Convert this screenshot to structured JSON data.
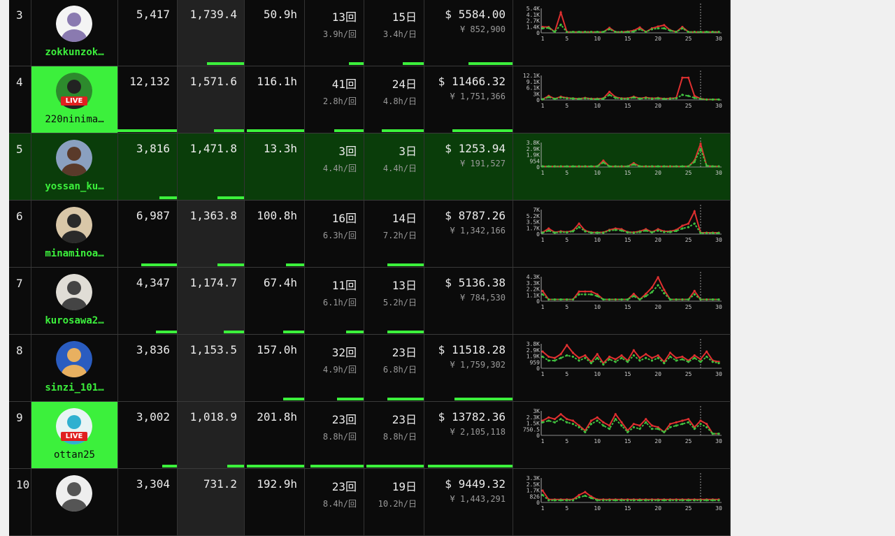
{
  "rows": [
    {
      "rank": "3",
      "user": "zokkunzok…",
      "live": false,
      "avatar": "robot-avatar",
      "followers": "5,417",
      "score": "1,739.4",
      "hours": "50.9h",
      "streams": "13回",
      "per_stream": "3.9h/回",
      "days": "15日",
      "per_day": "3.4h/日",
      "usd": "$ 5584.00",
      "jpy": "¥ 852,900",
      "bars": [
        0.0,
        0.55,
        0.0,
        0.25,
        0.35,
        0.5,
        0.55
      ],
      "y_ticks": [
        "5.4K",
        "4.1K",
        "2.7K",
        "1.4K",
        "0"
      ],
      "x_ticks": [
        "1",
        "5",
        "10",
        "15",
        "20",
        "25",
        "30"
      ],
      "red": [
        1.3,
        1.3,
        0.2,
        4.5,
        0.2,
        0.2,
        0.2,
        0.2,
        0.2,
        0.2,
        0.2,
        1.1,
        0.2,
        0.2,
        0.3,
        0.5,
        1.2,
        0.2,
        1.0,
        1.4,
        1.7,
        0.6,
        0.2,
        1.3,
        0.2,
        0.2,
        0.2,
        0.2,
        0.2,
        0.2
      ],
      "green": [
        1.0,
        1.1,
        0.2,
        1.8,
        0.2,
        0.2,
        0.2,
        0.2,
        0.2,
        0.2,
        0.2,
        0.8,
        0.2,
        0.2,
        0.2,
        0.3,
        0.8,
        0.2,
        0.8,
        1.0,
        1.0,
        0.5,
        0.2,
        1.0,
        0.2,
        0.2,
        0.2,
        0.2,
        0.2,
        0.2
      ],
      "ymax": 5.4
    },
    {
      "rank": "4",
      "user": "220ninima…",
      "live": true,
      "avatar": "cap-man-avatar",
      "followers": "12,132",
      "score": "1,571.6",
      "hours": "116.1h",
      "streams": "41回",
      "per_stream": "2.8h/回",
      "days": "24日",
      "per_day": "4.8h/日",
      "usd": "$ 11466.32",
      "jpy": "¥ 1,751,366",
      "bars": [
        1.0,
        0.45,
        0.95,
        0.5,
        0.7,
        0.68,
        0.85
      ],
      "y_ticks": [
        "12.1K",
        "9.1K",
        "6.1K",
        "3K",
        "0"
      ],
      "x_ticks": [
        "1",
        "5",
        "10",
        "15",
        "20",
        "25",
        "30"
      ],
      "red": [
        0.3,
        2.0,
        0.6,
        1.6,
        1.0,
        0.8,
        0.6,
        1.0,
        0.6,
        0.6,
        0.8,
        4.0,
        1.4,
        0.8,
        0.8,
        1.6,
        0.8,
        1.2,
        0.8,
        1.0,
        0.6,
        0.8,
        1.0,
        11.0,
        11.0,
        2.0,
        0.6,
        0.2,
        0.2,
        0.2
      ],
      "green": [
        0.3,
        1.4,
        0.5,
        1.2,
        0.8,
        0.7,
        0.5,
        0.8,
        0.5,
        0.4,
        0.6,
        2.5,
        1.0,
        0.6,
        0.6,
        1.2,
        0.6,
        0.9,
        0.6,
        0.8,
        0.5,
        0.6,
        0.8,
        2.5,
        2.0,
        1.0,
        0.5,
        0.2,
        0.2,
        0.2
      ],
      "ymax": 12.1
    },
    {
      "rank": "5",
      "user": "yossan_ku…",
      "live": false,
      "highlight": true,
      "avatar": "bearded-man-avatar",
      "followers": "3,816",
      "score": "1,471.8",
      "hours": "13.3h",
      "streams": "3回",
      "per_stream": "4.4h/回",
      "days": "3日",
      "per_day": "4.4h/日",
      "usd": "$ 1253.94",
      "jpy": "¥ 191,527",
      "bars": [
        0.3,
        0.4,
        0.0,
        0.0,
        0.0,
        0.0,
        0.05
      ],
      "y_ticks": [
        "3.8K",
        "2.9K",
        "1.9K",
        "954",
        "0"
      ],
      "x_ticks": [
        "1",
        "5",
        "10",
        "15",
        "20",
        "25",
        "30"
      ],
      "red": [
        0.1,
        0.1,
        0.1,
        0.1,
        0.1,
        0.1,
        0.1,
        0.1,
        0.1,
        0.1,
        1.0,
        0.1,
        0.1,
        0.1,
        0.1,
        0.6,
        0.1,
        0.1,
        0.1,
        0.1,
        0.1,
        0.1,
        0.1,
        0.1,
        0.1,
        1.0,
        3.6,
        0.2,
        0.1,
        0.1
      ],
      "green": [
        0.1,
        0.1,
        0.1,
        0.1,
        0.1,
        0.1,
        0.1,
        0.1,
        0.1,
        0.1,
        0.7,
        0.1,
        0.1,
        0.1,
        0.1,
        0.4,
        0.1,
        0.1,
        0.1,
        0.1,
        0.1,
        0.1,
        0.1,
        0.1,
        0.1,
        0.8,
        2.8,
        0.2,
        0.1,
        0.1
      ],
      "ymax": 3.8
    },
    {
      "rank": "6",
      "user": "minaminoa…",
      "live": false,
      "avatar": "glasses-man-avatar",
      "followers": "6,987",
      "score": "1,363.8",
      "hours": "100.8h",
      "streams": "16回",
      "per_stream": "6.3h/回",
      "days": "14日",
      "per_day": "7.2h/日",
      "usd": "$ 8787.26",
      "jpy": "¥ 1,342,166",
      "bars": [
        0.6,
        0.4,
        0.3,
        0.0,
        0.6,
        0.0,
        0.6
      ],
      "y_ticks": [
        "7K",
        "5.2K",
        "3.5K",
        "1.7K",
        "0"
      ],
      "x_ticks": [
        "1",
        "5",
        "10",
        "15",
        "20",
        "25",
        "30"
      ],
      "red": [
        0.5,
        1.6,
        0.5,
        0.8,
        0.6,
        1.0,
        3.0,
        1.0,
        0.5,
        0.5,
        0.5,
        1.2,
        1.6,
        1.4,
        0.6,
        0.5,
        0.8,
        1.4,
        0.6,
        1.4,
        0.8,
        0.8,
        1.2,
        2.4,
        3.0,
        6.5,
        0.4,
        0.4,
        0.4,
        0.4
      ],
      "green": [
        0.4,
        1.0,
        0.4,
        0.6,
        0.5,
        0.8,
        2.0,
        0.8,
        0.4,
        0.4,
        0.4,
        1.0,
        1.2,
        1.0,
        0.5,
        0.4,
        0.6,
        1.0,
        0.5,
        1.0,
        0.6,
        0.6,
        0.9,
        1.6,
        2.0,
        3.0,
        0.3,
        0.3,
        0.3,
        0.3
      ],
      "ymax": 7.0
    },
    {
      "rank": "7",
      "user": "kurosawa2…",
      "live": false,
      "avatar": "standing-man-avatar",
      "followers": "4,347",
      "score": "1,174.7",
      "hours": "67.4h",
      "streams": "11回",
      "per_stream": "6.1h/回",
      "days": "13日",
      "per_day": "5.2h/日",
      "usd": "$ 5136.38",
      "jpy": "¥ 784,530",
      "bars": [
        0.35,
        0.3,
        0.35,
        0.3,
        0.6,
        0.0,
        0.3
      ],
      "y_ticks": [
        "4.3K",
        "3.3K",
        "2.2K",
        "1.1K",
        "0"
      ],
      "x_ticks": [
        "1",
        "5",
        "10",
        "15",
        "20",
        "25",
        "30"
      ],
      "red": [
        1.8,
        0.3,
        0.3,
        0.3,
        0.3,
        0.3,
        1.7,
        1.7,
        1.7,
        1.2,
        0.3,
        0.3,
        0.3,
        0.3,
        0.3,
        1.3,
        0.3,
        1.3,
        2.4,
        4.2,
        2.0,
        0.3,
        0.3,
        0.3,
        0.3,
        1.8,
        0.3,
        0.3,
        0.3,
        0.3
      ],
      "green": [
        1.2,
        0.3,
        0.3,
        0.3,
        0.3,
        0.3,
        1.2,
        1.2,
        1.2,
        0.9,
        0.3,
        0.3,
        0.3,
        0.3,
        0.3,
        0.9,
        0.3,
        0.9,
        1.6,
        2.8,
        1.4,
        0.3,
        0.3,
        0.3,
        0.3,
        1.2,
        0.3,
        0.3,
        0.3,
        0.3
      ],
      "ymax": 4.3
    },
    {
      "rank": "8",
      "user": "sinzi_101…",
      "live": false,
      "avatar": "cartoon-badge-avatar",
      "followers": "3,836",
      "score": "1,153.5",
      "hours": "157.0h",
      "streams": "32回",
      "per_stream": "4.9h/回",
      "days": "23日",
      "per_day": "6.8h/日",
      "usd": "$ 11518.28",
      "jpy": "¥ 1,759,302",
      "bars": [
        0.0,
        0.0,
        0.35,
        0.45,
        0.6,
        0.65,
        0.5
      ],
      "y_ticks": [
        "3.8K",
        "2.9K",
        "1.9K",
        "959",
        "0"
      ],
      "x_ticks": [
        "1",
        "5",
        "10",
        "15",
        "20",
        "25",
        "30"
      ],
      "red": [
        2.6,
        1.8,
        1.6,
        2.2,
        3.6,
        2.4,
        1.6,
        2.0,
        1.0,
        2.2,
        0.8,
        1.8,
        1.4,
        2.0,
        1.2,
        2.8,
        1.6,
        2.2,
        1.6,
        2.0,
        1.0,
        2.4,
        1.6,
        1.8,
        1.2,
        2.0,
        1.4,
        2.6,
        1.2,
        1.0
      ],
      "green": [
        1.8,
        1.2,
        1.2,
        1.6,
        2.0,
        1.8,
        1.2,
        1.6,
        0.8,
        1.6,
        0.6,
        1.4,
        1.0,
        1.6,
        1.0,
        2.0,
        1.2,
        1.6,
        1.2,
        1.6,
        0.8,
        1.8,
        1.2,
        1.4,
        1.0,
        1.6,
        1.0,
        1.8,
        1.0,
        0.8
      ],
      "ymax": 3.8
    },
    {
      "rank": "9",
      "user": "ottan25",
      "live": true,
      "avatar": "blue-character-avatar",
      "followers": "3,002",
      "score": "1,018.9",
      "hours": "201.8h",
      "streams": "23回",
      "per_stream": "8.8h/回",
      "days": "23日",
      "per_day": "8.8h/日",
      "usd": "$ 13782.36",
      "jpy": "¥ 2,105,118",
      "bars": [
        0.25,
        0.25,
        0.95,
        0.9,
        0.95,
        0.95,
        0.8
      ],
      "y_ticks": [
        "3K",
        "2.3K",
        "1.5K",
        "750.5",
        "0"
      ],
      "x_ticks": [
        "1",
        "5",
        "10",
        "15",
        "20",
        "25",
        "30"
      ],
      "red": [
        1.8,
        2.2,
        2.0,
        2.6,
        2.0,
        1.8,
        1.2,
        0.6,
        1.8,
        2.2,
        1.6,
        1.2,
        2.6,
        1.6,
        0.6,
        1.4,
        1.2,
        2.0,
        1.2,
        1.0,
        0.4,
        1.4,
        1.6,
        1.8,
        2.0,
        1.0,
        1.8,
        1.4,
        0.2,
        0.2
      ],
      "green": [
        1.6,
        1.8,
        1.6,
        2.0,
        1.6,
        1.4,
        1.0,
        0.4,
        1.4,
        1.8,
        1.2,
        0.8,
        2.0,
        1.2,
        0.4,
        1.0,
        0.8,
        1.6,
        0.8,
        0.8,
        0.4,
        1.0,
        1.2,
        1.4,
        1.6,
        0.8,
        1.4,
        1.0,
        0.2,
        0.2
      ],
      "ymax": 3.0
    },
    {
      "rank": "10",
      "user": "",
      "live": false,
      "avatar": "sketch-man-avatar",
      "followers": "3,304",
      "score": "731.2",
      "hours": "192.9h",
      "streams": "23回",
      "per_stream": "8.4h/回",
      "days": "19日",
      "per_day": "10.2h/日",
      "usd": "$ 9449.32",
      "jpy": "¥ 1,443,291",
      "bars": [
        0,
        0,
        0,
        0,
        0,
        0,
        0
      ],
      "y_ticks": [
        "3.3K",
        "2.5K",
        "1.7K",
        "826",
        "0"
      ],
      "x_ticks": [
        "1",
        "5",
        "10",
        "15",
        "20",
        "25",
        "30"
      ],
      "red": [
        1.6,
        0.4,
        0.4,
        0.4,
        0.4,
        0.4,
        1.0,
        1.4,
        0.8,
        0.4,
        0.4,
        0.4,
        0.4,
        0.4,
        0.4,
        0.4,
        0.4,
        0.4,
        0.4,
        0.4,
        0.4,
        0.4,
        0.4,
        0.4,
        0.4,
        0.4,
        0.4,
        0.4,
        0.4,
        0.4
      ],
      "green": [
        1.0,
        0.3,
        0.3,
        0.3,
        0.3,
        0.3,
        0.7,
        0.9,
        0.6,
        0.3,
        0.3,
        0.3,
        0.3,
        0.3,
        0.3,
        0.3,
        0.3,
        0.3,
        0.3,
        0.3,
        0.3,
        0.3,
        0.3,
        0.3,
        0.3,
        0.3,
        0.3,
        0.3,
        0.3,
        0.3
      ],
      "ymax": 3.3
    }
  ],
  "colors": {
    "accent": "#3cf03c",
    "red_line": "#e03030",
    "green_line": "#3fbf3f",
    "highlight_row": "#0a3d0a",
    "live_badge": "#e02020"
  },
  "live_label": "LIVE"
}
